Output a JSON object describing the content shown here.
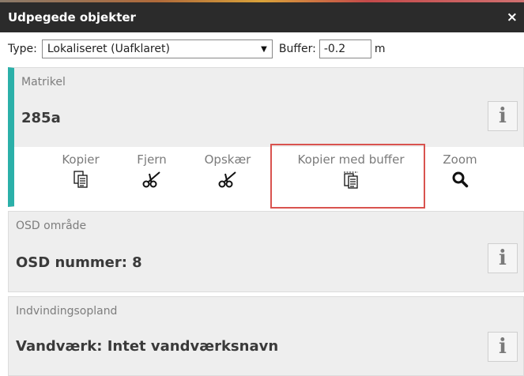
{
  "window": {
    "title": "Udpegede objekter",
    "close_glyph": "×"
  },
  "filter": {
    "type_label": "Type:",
    "type_value": "Lokaliseret (Uafklaret)",
    "buffer_label": "Buffer:",
    "buffer_value": "-0.2",
    "buffer_unit": "m"
  },
  "cards": [
    {
      "label": "Matrikel",
      "value": "285a",
      "info": "i",
      "selected": true,
      "actions": [
        {
          "label": "Kopier",
          "icon": "copy-icon"
        },
        {
          "label": "Fjern",
          "icon": "scissors-icon"
        },
        {
          "label": "Opskær",
          "icon": "scissors-icon"
        },
        {
          "label": "Kopier med buffer",
          "icon": "copy-buffer-icon",
          "highlighted": true
        },
        {
          "label": "Zoom",
          "icon": "search-icon"
        }
      ]
    },
    {
      "label": "OSD område",
      "value": "OSD nummer: 8",
      "info": "i"
    },
    {
      "label": "Indvindingsopland",
      "value": "Vandværk: Intet vandværksnavn",
      "info": "i"
    }
  ],
  "colors": {
    "titlebar": "#2b2b2b",
    "selection_accent": "#2bb0a9",
    "highlight": "#d9534f",
    "card_bg": "#eeeeee"
  }
}
